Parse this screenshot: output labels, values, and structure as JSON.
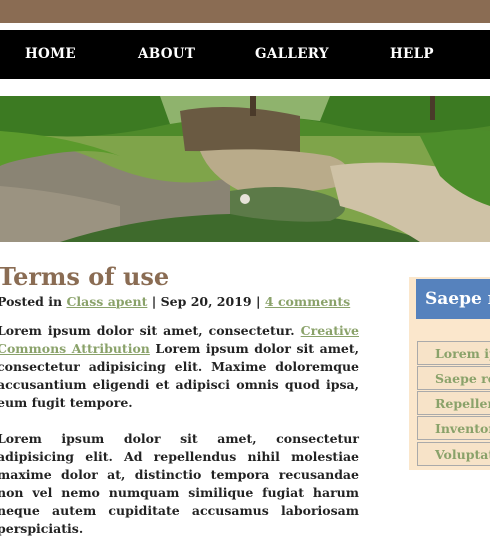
{
  "nav": {
    "items": [
      {
        "label": "HOME"
      },
      {
        "label": "ABOUT"
      },
      {
        "label": "GALLERY"
      },
      {
        "label": "HELP"
      }
    ]
  },
  "post": {
    "title": "Terms of use",
    "meta": {
      "prefix": "Posted in",
      "category": "Class apent",
      "sep1": "|",
      "date": "Sep 20, 2019",
      "sep2": "|",
      "comments": "4 comments"
    },
    "paragraphs": [
      {
        "text1": "Lorem ipsum dolor sit amet, consectetur.",
        "link": "Creative Commons Attribution",
        "text2": "Lorem ipsum dolor sit amet, consectetur adipisicing elit. Maxime doloremque accusantium eligendi et adipisci omnis quod ipsa, eum fugit tempore."
      },
      {
        "text": "Lorem ipsum dolor sit amet, consectetur adipisicing elit. Ad repellendus nihil molestiae maxime dolor at, distinctio tempora recusandae non vel nemo numquam similique fugiat harum neque autem cupiditate accusamus laboriosam perspiciatis."
      }
    ]
  },
  "sidebar": {
    "title": "Saepe r",
    "links": [
      {
        "label": "Lorem ips"
      },
      {
        "label": "Saepe rep"
      },
      {
        "label": "Repellend"
      },
      {
        "label": "Inventore"
      },
      {
        "label": "Voluptate"
      }
    ]
  },
  "colors": {
    "brand_brown": "#8a6c53",
    "nav_bg": "#000000",
    "link_green": "#8aa26a",
    "sidebar_title_bg": "#5682bd",
    "sidebar_bg": "#fbe7cc"
  }
}
